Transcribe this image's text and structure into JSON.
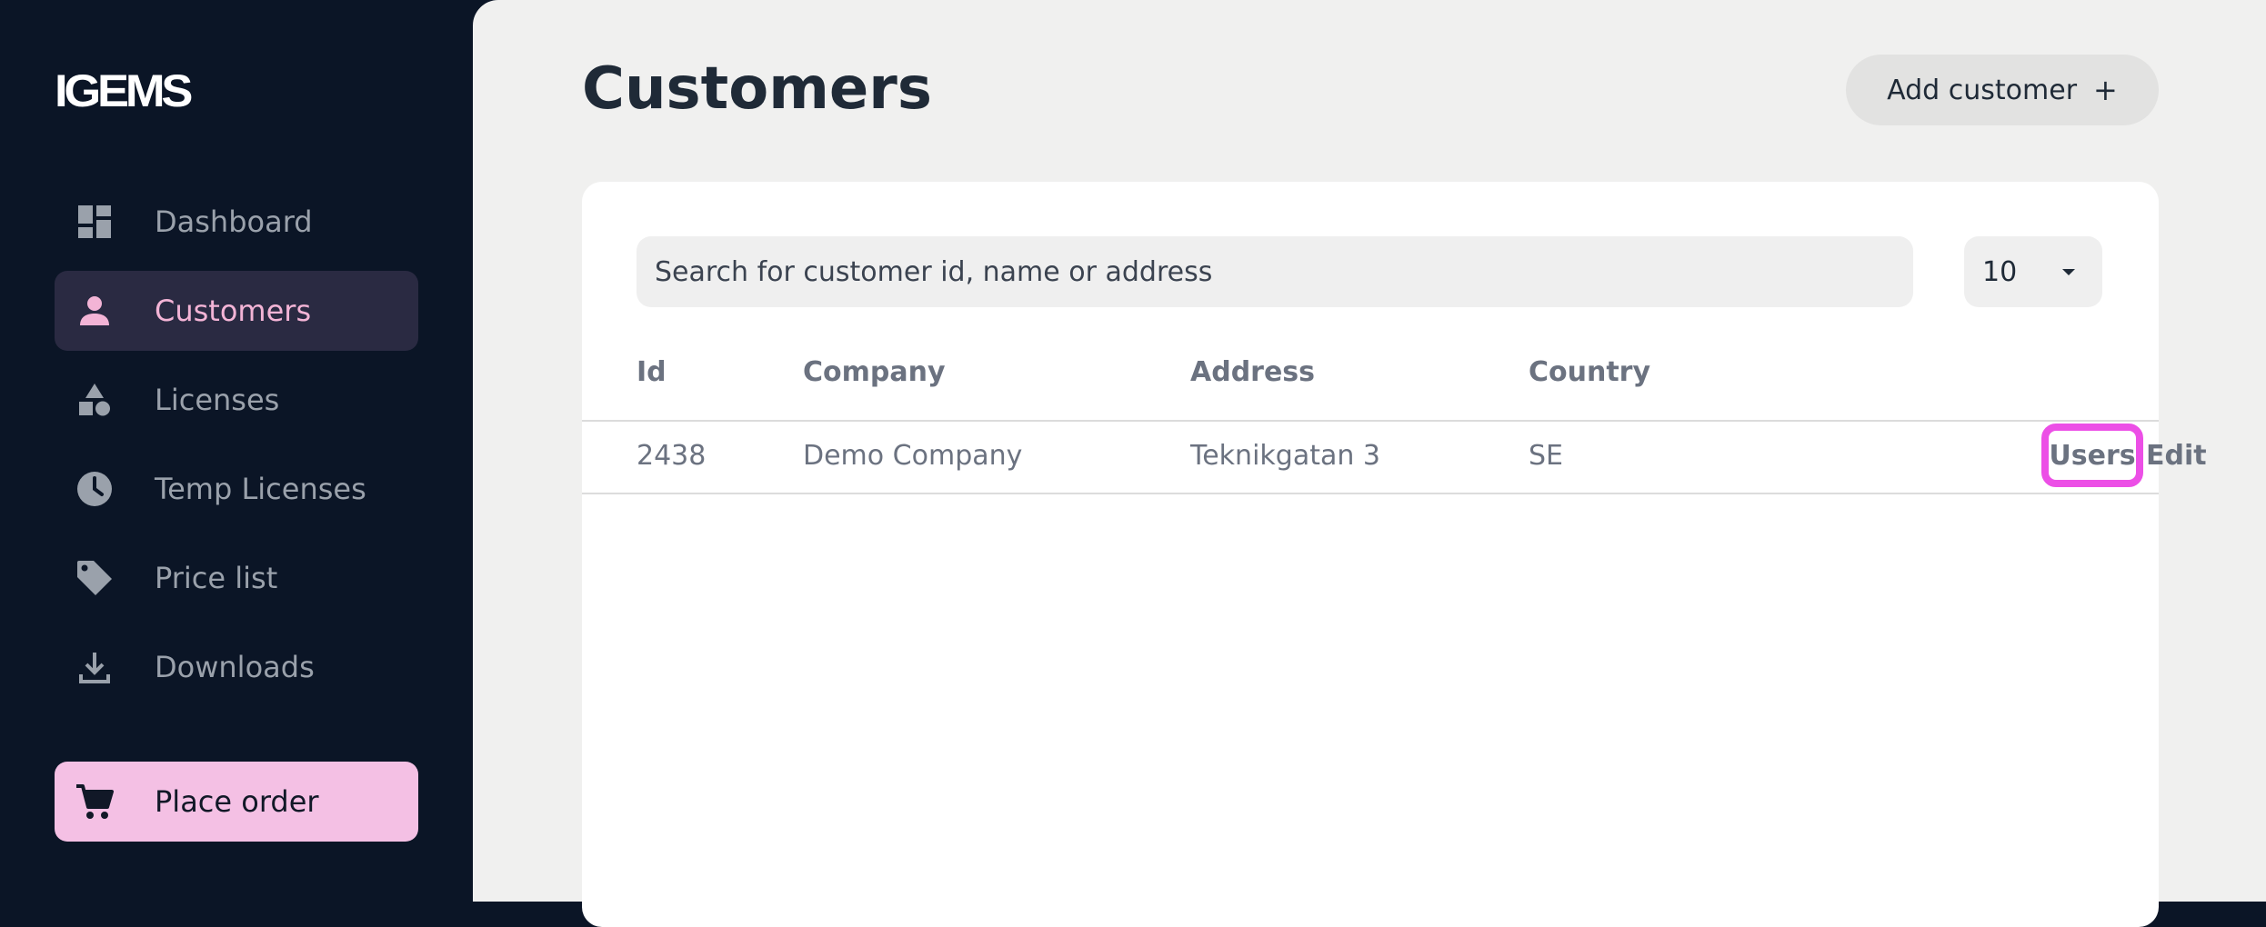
{
  "sidebar": {
    "logo": "IGEMS",
    "items": [
      {
        "label": "Dashboard",
        "icon": "dashboard-icon"
      },
      {
        "label": "Customers",
        "icon": "person-icon",
        "active": true
      },
      {
        "label": "Licenses",
        "icon": "shapes-icon"
      },
      {
        "label": "Temp Licenses",
        "icon": "clock-icon"
      },
      {
        "label": "Price list",
        "icon": "tag-icon"
      },
      {
        "label": "Downloads",
        "icon": "download-icon"
      }
    ],
    "place_order": {
      "label": "Place order",
      "icon": "cart-icon"
    }
  },
  "header": {
    "title": "Customers",
    "add_button": {
      "label": "Add customer",
      "icon": "+"
    }
  },
  "controls": {
    "search_placeholder": "Search for customer id, name or address",
    "page_size": "10"
  },
  "table": {
    "columns": [
      "Id",
      "Company",
      "Address",
      "Country"
    ],
    "rows": [
      {
        "id": "2438",
        "company": "Demo Company",
        "address": "Teknikgatan 3",
        "country": "SE",
        "actions": [
          "Users",
          "Edit"
        ]
      }
    ]
  },
  "colors": {
    "sidebar_bg": "#0b1526",
    "active_item_bg": "#2a2a42",
    "active_item_text": "#f3b4d6",
    "place_order_bg": "#f4c0e4",
    "highlight": "#ec4fe6"
  }
}
